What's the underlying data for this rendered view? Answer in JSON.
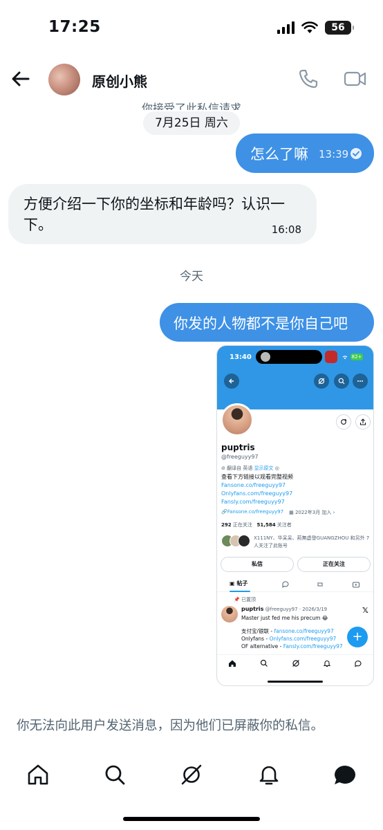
{
  "status_bar": {
    "time": "17:25",
    "battery": "56",
    "icons": [
      "signal-icon",
      "wifi-icon",
      "battery-icon"
    ]
  },
  "header": {
    "contact_name": "原创小熊",
    "icons": [
      "back-arrow-icon",
      "phone-icon",
      "video-icon"
    ]
  },
  "chat": {
    "request_note": "你接受了此私信请求",
    "date_chip": "7月25日 周六",
    "messages": [
      {
        "direction": "out",
        "text": "怎么了嘛",
        "time": "13:39"
      },
      {
        "direction": "in",
        "text": "方便介绍一下你的坐标和年龄吗？认识一下。",
        "time": "16:08"
      },
      {
        "direction": "out",
        "text": "你发的人物都不是你自己吧"
      }
    ],
    "today_label": "今天"
  },
  "shared_screenshot": {
    "status_time": "13:40",
    "battery": "82+",
    "profile": {
      "name": "puptris",
      "handle": "@freeguyy97",
      "translated_from": "翻译自 英语",
      "show_original": "显示原文",
      "bio_line": "查看下方链接以观看完整视频",
      "bio_links": [
        "Fansone.co/freeguyy97",
        "Onlyfans.com/freeguyy97",
        "Fansly.com/freeguyy97"
      ],
      "website": "Fansone.co/freeguyy97",
      "joined": "2022年3月 加入",
      "following_count": "292",
      "following_label": "正在关注",
      "followers_count": "51,584",
      "followers_label": "关注者",
      "followed_by": "X111NY、华呆呆、荊無虚發GUANGZHOU 和另外 7 人关注了此账号",
      "message_button": "私信",
      "following_button": "正在关注",
      "tab_posts": "帖子"
    },
    "pinned_post": {
      "pinned_label": "已置顶",
      "author": "puptris",
      "meta": "@freeguyy97 · 2026/3/19",
      "text": "Master just fed me his precum 😂",
      "lines": [
        {
          "label": "支付宝/银联 - ",
          "link": "fansone.co/freeguyy97"
        },
        {
          "label": "Onlyfans - ",
          "link": "Onlyfans.com/freeguyy97"
        },
        {
          "label": "OF alternative - ",
          "link": "Fansly.com/freeguyy97"
        }
      ]
    }
  },
  "blocked_notice": "你无法向此用户发送消息，因为他们已屏蔽你的私信。",
  "bottom_nav": [
    "home-icon",
    "search-icon",
    "grok-icon",
    "notifications-icon",
    "messages-icon"
  ],
  "colors": {
    "accent": "#3e91e5",
    "incoming_bubble": "#eff3f4",
    "muted_text": "#536471",
    "link": "#1d9bf0"
  }
}
